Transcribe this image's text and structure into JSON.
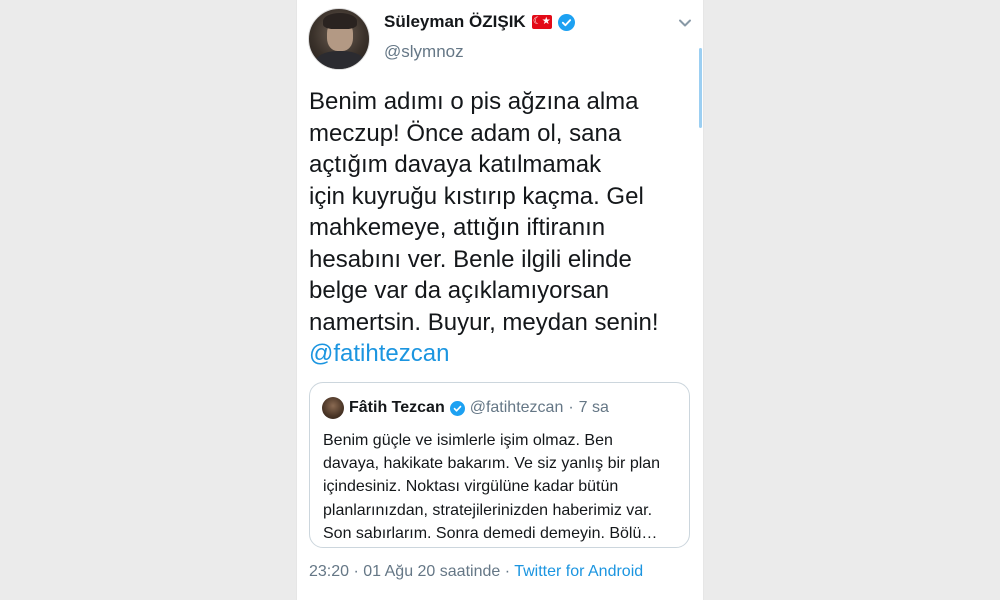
{
  "tweet": {
    "author": {
      "display_name": "Süleyman ÖZIŞIK",
      "handle": "@slymnoz",
      "flag": "☾★"
    },
    "text_lines": [
      "Benim adımı o pis ağzına alma",
      "meczup! Önce adam ol, sana",
      "açtığım davaya katılmamak",
      "için kuyruğu kıstırıp kaçma. Gel",
      "mahkemeye, attığın iftiranın",
      "hesabını ver. Benle ilgili elinde",
      "belge var da açıklamıyorsan",
      "namertsin. Buyur, meydan senin!"
    ],
    "mention": "@fatihtezcan",
    "timestamp": "23:20 · 01 Ağu 20 saatinde ·",
    "source_app": "Twitter for Android"
  },
  "quote": {
    "display_name": "Fâtih Tezcan",
    "handle": "@fatihtezcan",
    "separator": "·",
    "time": "7 sa",
    "text_lines": [
      "Benim güçle ve isimlerle işim olmaz. Ben",
      "davaya, hakikate bakarım. Ve siz yanlış bir plan",
      "içindesiniz. Noktası virgülüne kadar bütün",
      "planlarınızdan, stratejilerinizden haberimiz var.",
      "Son sabırlarım. Sonra demedi demeyin. Bölü…"
    ]
  },
  "icons": {
    "verified": "verified-badge-icon",
    "more": "chevron-down-icon"
  },
  "colors": {
    "accent": "#1da1f2",
    "link": "#1b95e0",
    "muted": "#657786",
    "text": "#14171a",
    "flag_red": "#e30a17"
  }
}
